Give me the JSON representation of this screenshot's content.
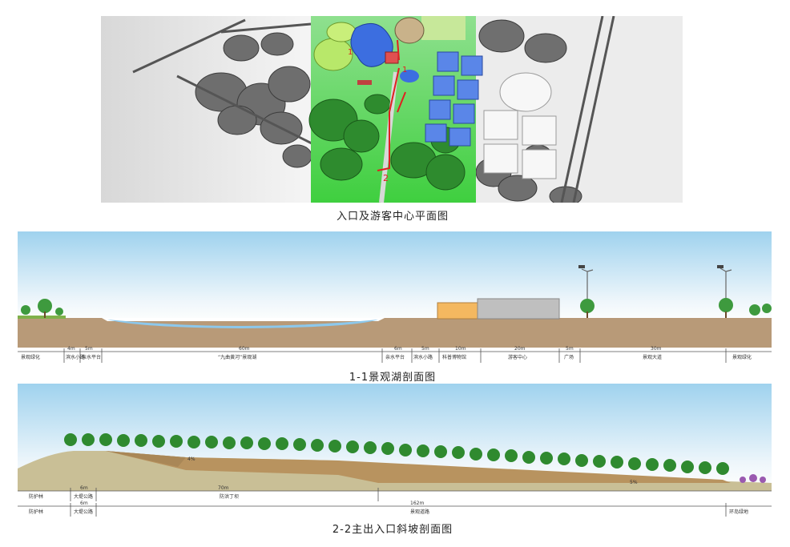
{
  "plan": {
    "caption": "入口及游客中心平面图",
    "marker1": "1",
    "marker1b": "1",
    "marker2": "2"
  },
  "section1": {
    "caption": "1-1景观湖剖面图",
    "dims": [
      "4m",
      "5m",
      "60m",
      "6m",
      "5m",
      "10m",
      "20m",
      "5m",
      "30m"
    ],
    "labels": [
      "景观绿化",
      "滨水小路",
      "亲水平台",
      "“九曲黄河”景观湖",
      "亲水平台",
      "滨水小路",
      "科普博物馆",
      "游客中心",
      "广场",
      "景观大道",
      "景观绿化"
    ]
  },
  "section2": {
    "caption": "2-2主出入口斜坡剖面图",
    "slope_a": "4%",
    "slope_b": "5%",
    "row1_dims": [
      "6m",
      "70m"
    ],
    "row1_labels": [
      "防护林",
      "大堤公路",
      "防洪丁坝"
    ],
    "row2_dims": [
      "6m",
      "162m"
    ],
    "row2_labels": [
      "防护林",
      "大堤公路",
      "景观道路",
      "环岛绿地"
    ]
  },
  "colors": {
    "sky_top": "#9fd2ee",
    "ground": "#b89a78",
    "water": "#8cc8ec",
    "green_zone": "#5fd35f",
    "route": "#e02020"
  }
}
